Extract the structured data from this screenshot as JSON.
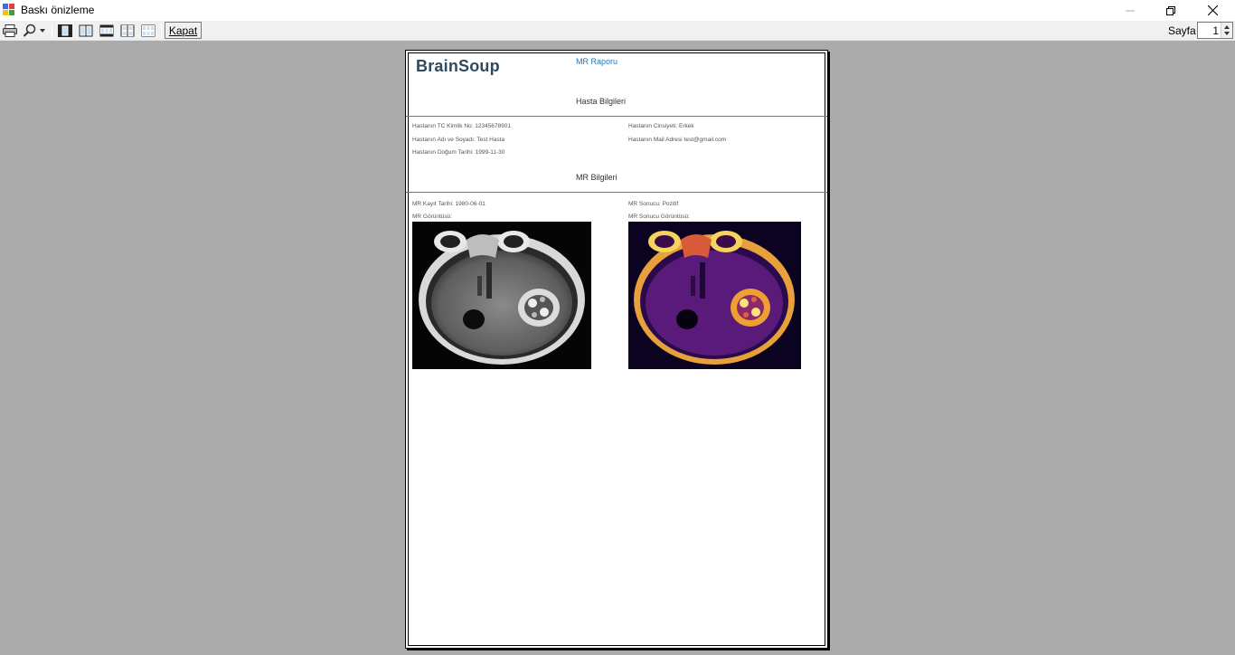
{
  "window": {
    "title": "Baskı önizleme"
  },
  "toolbar": {
    "close_label": "Kapat",
    "page_label": "Sayfa",
    "page_value": "1"
  },
  "report": {
    "logo": "BrainSoup",
    "title": "MR Raporu",
    "patient_section_title": "Hasta Bilgileri",
    "patient": {
      "tc": "Hastanın TC Kimlik No: 12345678901",
      "name": "Hastanın Adı ve Soyadı: Test  Hasta",
      "birth": "Hastanın Doğum Tarihi: 1999-11-30",
      "gender": "Hastanın Cinsiyeti: Erkek",
      "mail": "Hastanın Mail Adresi test@gmail.com"
    },
    "mr_section_title": "MR Bilgileri",
    "mr": {
      "record_date": "MR Kayıt Tarihi: 1980-06-01",
      "image_label": "MR Görüntüsü:",
      "result": "MR Sonucu: Pozitif",
      "result_image_label": "MR Sonucu Görüntüsü:"
    }
  }
}
